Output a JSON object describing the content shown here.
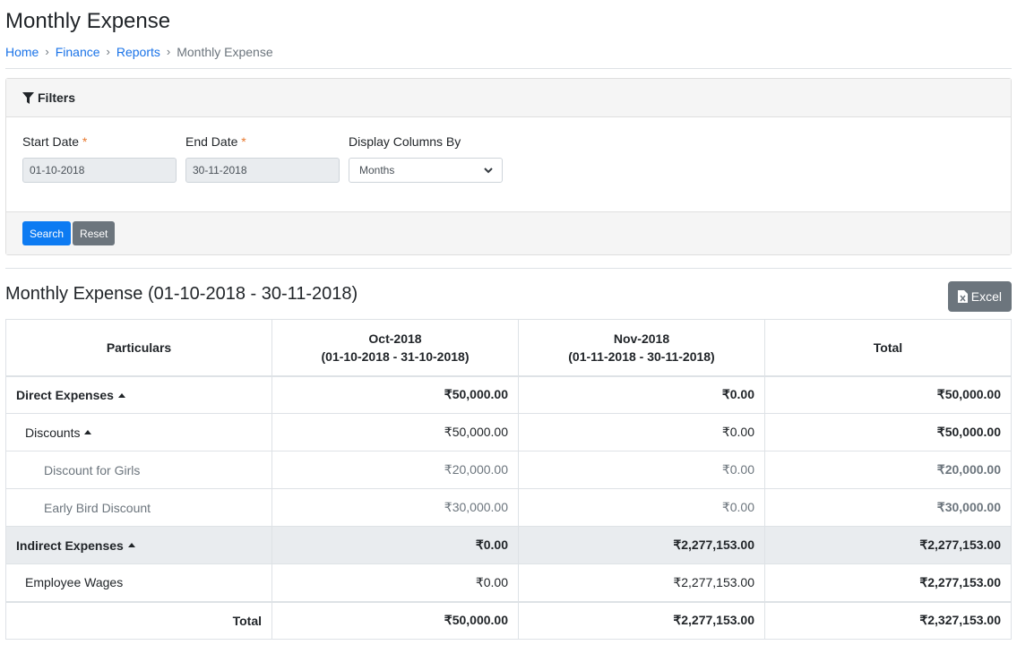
{
  "header": {
    "title": "Monthly Expense",
    "breadcrumb": [
      {
        "label": "Home"
      },
      {
        "label": "Finance"
      },
      {
        "label": "Reports"
      },
      {
        "label": "Monthly Expense"
      }
    ]
  },
  "filters": {
    "title": "Filters",
    "icon": "filter-icon",
    "start_date": {
      "label": "Start Date",
      "required_mark": "*",
      "value": "01-10-2018"
    },
    "end_date": {
      "label": "End Date",
      "required_mark": "*",
      "value": "30-11-2018"
    },
    "display_columns_by": {
      "label": "Display Columns By",
      "value": "Months"
    },
    "search_label": "Search",
    "reset_label": "Reset"
  },
  "report": {
    "title": "Monthly Expense (01-10-2018 - 30-11-2018)",
    "excel_label": "Excel",
    "columns": [
      {
        "line1": "Particulars",
        "line2": ""
      },
      {
        "line1": "Oct-2018",
        "line2": "(01-10-2018 - 31-10-2018)"
      },
      {
        "line1": "Nov-2018",
        "line2": "(01-11-2018 - 30-11-2018)"
      },
      {
        "line1": "Total",
        "line2": ""
      }
    ],
    "rows": [
      {
        "label": "Direct Expenses",
        "oct": "₹50,000.00",
        "nov": "₹0.00",
        "total": "₹50,000.00"
      },
      {
        "label": "Discounts",
        "oct": "₹50,000.00",
        "nov": "₹0.00",
        "total": "₹50,000.00"
      },
      {
        "label": "Discount for Girls",
        "oct": "₹20,000.00",
        "nov": "₹0.00",
        "total": "₹20,000.00"
      },
      {
        "label": "Early Bird Discount",
        "oct": "₹30,000.00",
        "nov": "₹0.00",
        "total": "₹30,000.00"
      },
      {
        "label": "Indirect Expenses",
        "oct": "₹0.00",
        "nov": "₹2,277,153.00",
        "total": "₹2,277,153.00"
      },
      {
        "label": "Employee Wages",
        "oct": "₹0.00",
        "nov": "₹2,277,153.00",
        "total": "₹2,277,153.00"
      }
    ],
    "total_row": {
      "label": "Total",
      "oct": "₹50,000.00",
      "nov": "₹2,277,153.00",
      "total": "₹2,327,153.00"
    }
  }
}
